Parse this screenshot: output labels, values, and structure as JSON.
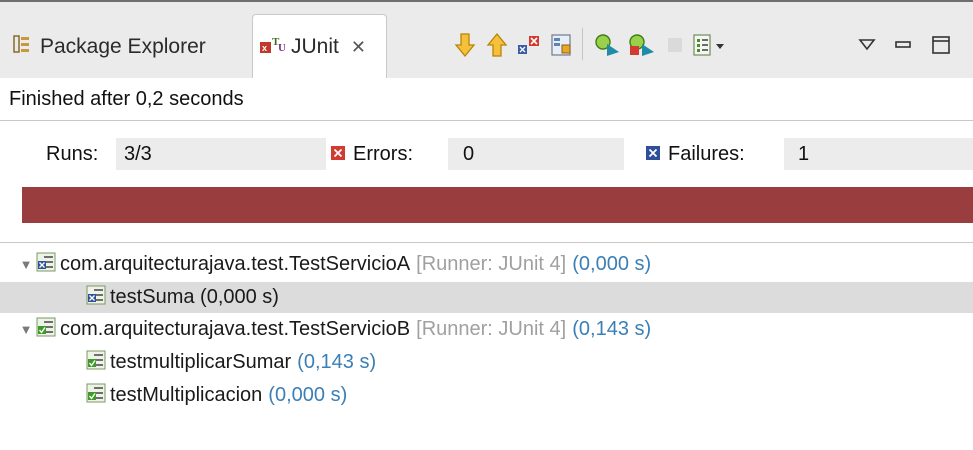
{
  "tabs": {
    "package_explorer": "Package Explorer",
    "junit": "JUnit",
    "junit_close": "✕"
  },
  "toolbar_icons": [
    "next-failure-icon",
    "previous-failure-icon",
    "show-failures-only-icon",
    "scroll-lock-icon",
    "rerun-test-icon",
    "rerun-failed-first-icon",
    "stop-icon",
    "test-run-history-icon",
    "view-menu-icon",
    "minimize-icon",
    "maximize-icon"
  ],
  "status": "Finished after 0,2 seconds",
  "counters": {
    "runs_label": "Runs:",
    "runs_value": "3/3",
    "errors_label": "Errors:",
    "errors_value": "0",
    "failures_label": "Failures:",
    "failures_value": "1"
  },
  "progress": {
    "fraction": 1.0,
    "color": "#9a3d3e",
    "state": "failure"
  },
  "tree": [
    {
      "name": "com.arquitecturajava.test.TestServicioA",
      "meta": "[Runner: JUnit 4]",
      "time": "(0,000 s)",
      "status": "failed"
    },
    {
      "name": "testSuma (0,000 s)",
      "status": "failed",
      "selected": true
    },
    {
      "name": "com.arquitecturajava.test.TestServicioB",
      "meta": "[Runner: JUnit 4]",
      "time": "(0,143 s)",
      "status": "passed"
    },
    {
      "name": "testmultiplicarSumar",
      "time": "(0,143 s)",
      "status": "passed"
    },
    {
      "name": "testMultiplicacion",
      "time": "(0,000 s)",
      "status": "passed"
    }
  ],
  "colors": {
    "accent_time": "#3b7fb6",
    "failure_bar": "#9a3d3e",
    "selection": "#dcdcdc"
  }
}
